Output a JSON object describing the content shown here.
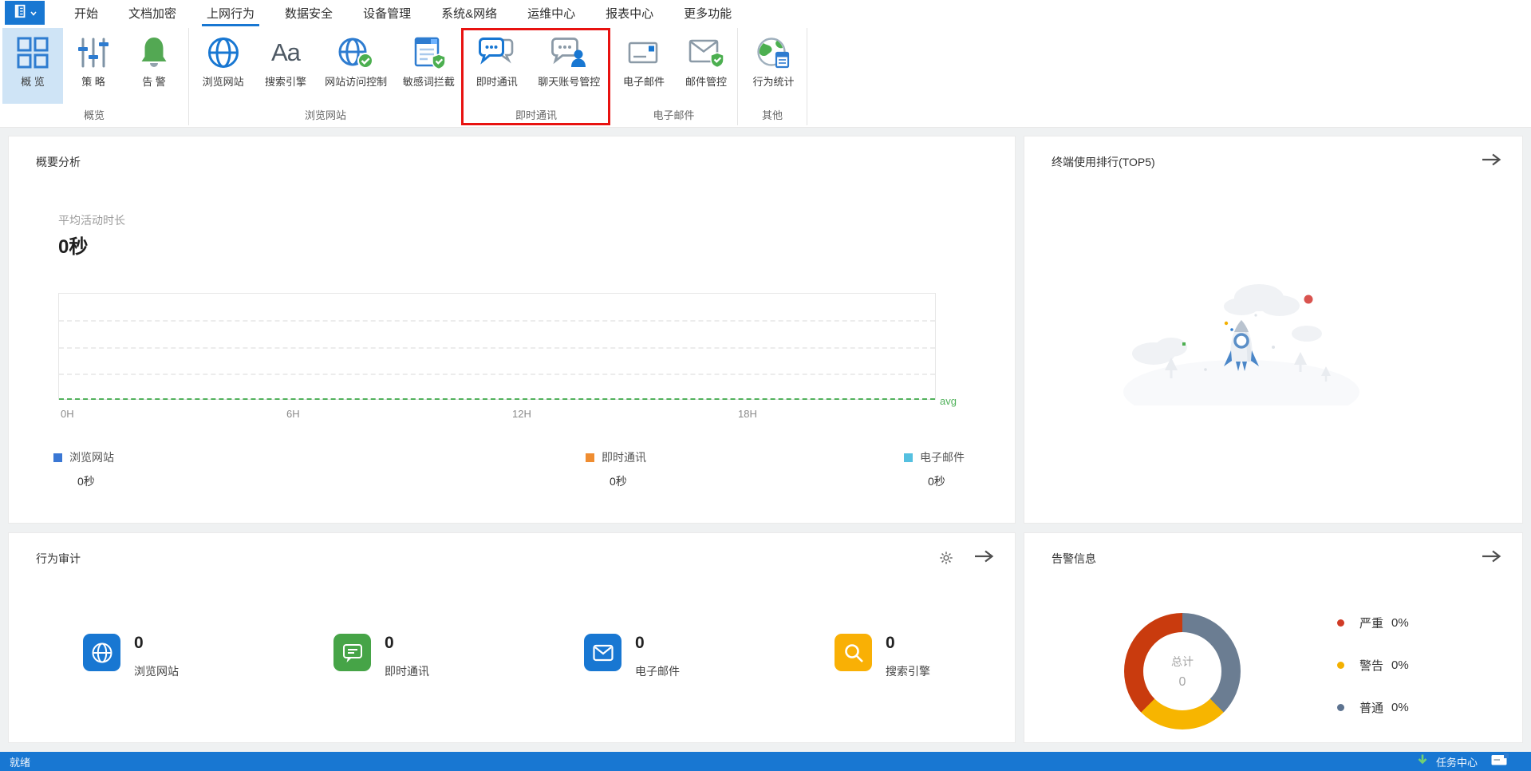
{
  "menu": {
    "items": [
      {
        "label": "开始"
      },
      {
        "label": "文档加密"
      },
      {
        "label": "上网行为",
        "active": true
      },
      {
        "label": "数据安全"
      },
      {
        "label": "设备管理"
      },
      {
        "label": "系统&网络"
      },
      {
        "label": "运维中心"
      },
      {
        "label": "报表中心"
      },
      {
        "label": "更多功能"
      }
    ]
  },
  "ribbon": {
    "groups": [
      {
        "label": "概览",
        "items": [
          {
            "label": "概 览",
            "icon": "overview-grid-icon",
            "selected": true
          },
          {
            "label": "策 略",
            "icon": "policy-sliders-icon"
          },
          {
            "label": "告 警",
            "icon": "alert-bell-icon"
          }
        ]
      },
      {
        "label": "浏览网站",
        "items": [
          {
            "label": "浏览网站",
            "icon": "browse-globe-icon"
          },
          {
            "label": "搜索引擎",
            "icon": "search-engine-aa-icon",
            "glyph": "Aa"
          },
          {
            "label": "网站访问控制",
            "icon": "site-access-globe-check-icon"
          },
          {
            "label": "敏感词拦截",
            "icon": "sensitive-word-shield-icon"
          }
        ]
      },
      {
        "label": "即时通讯",
        "highlighted_red_box": true,
        "items": [
          {
            "label": "即时通讯",
            "icon": "im-chat-icon"
          },
          {
            "label": "聊天账号管控",
            "icon": "chat-account-user-icon"
          }
        ]
      },
      {
        "label": "电子邮件",
        "items": [
          {
            "label": "电子邮件",
            "icon": "email-card-icon"
          },
          {
            "label": "邮件管控",
            "icon": "mail-shield-icon"
          }
        ]
      },
      {
        "label": "其他",
        "items": [
          {
            "label": "行为统计",
            "icon": "behavior-stats-globe-icon"
          }
        ]
      }
    ]
  },
  "cards": {
    "summary": {
      "title": "概要分析",
      "avg_label": "平均活动时长",
      "avg_value": "0秒"
    },
    "top5": {
      "title": "终端使用排行(TOP5)"
    },
    "audit": {
      "title": "行为审计",
      "stats": [
        {
          "value": "0",
          "label": "浏览网站",
          "color": "#1877d2",
          "icon": "globe-icon"
        },
        {
          "value": "0",
          "label": "即时通讯",
          "color": "#46a447",
          "icon": "chat-icon"
        },
        {
          "value": "0",
          "label": "电子邮件",
          "color": "#1877d2",
          "icon": "mail-icon"
        },
        {
          "value": "0",
          "label": "搜索引擎",
          "color": "#f9b005",
          "icon": "search-icon"
        }
      ]
    },
    "alarm": {
      "title": "告警信息"
    }
  },
  "chart_data": [
    {
      "type": "line",
      "title": "概要分析",
      "subtitle": "平均活动时长 0秒",
      "x_ticks": [
        "0H",
        "6H",
        "12H",
        "18H"
      ],
      "x_range_hours": [
        0,
        24
      ],
      "ylim": [
        0,
        1
      ],
      "grid": "dashed-horizontal",
      "series": [
        {
          "name": "浏览网站",
          "color": "#3a77d4",
          "total": "0秒",
          "values": [
            0,
            0,
            0,
            0,
            0
          ]
        },
        {
          "name": "即时通讯",
          "color": "#ef8d31",
          "total": "0秒",
          "values": [
            0,
            0,
            0,
            0,
            0
          ]
        },
        {
          "name": "电子邮件",
          "color": "#55c0e0",
          "total": "0秒",
          "values": [
            0,
            0,
            0,
            0,
            0
          ]
        }
      ],
      "avg_line": {
        "label": "avg",
        "value": 0,
        "color": "#52b25c",
        "style": "dashed"
      }
    },
    {
      "type": "donut",
      "title": "告警信息",
      "center_label": "总计",
      "center_value": "0",
      "legend_position": "right",
      "slices": [
        {
          "label": "严重",
          "pct": "0%",
          "color": "#c93b0e",
          "sweep_deg": 135
        },
        {
          "label": "警告",
          "pct": "0%",
          "color": "#f7b500",
          "sweep_deg": 90
        },
        {
          "label": "普通",
          "pct": "0%",
          "color": "#6b7d92",
          "sweep_deg": 135
        }
      ]
    }
  ],
  "statusbar": {
    "left": "就绪",
    "task_center": "任务中心"
  },
  "colors": {
    "primary_blue": "#1877d2",
    "selected_item_bg": "#cfe4f6",
    "highlight_red_box": "#e81210",
    "content_bg": "#eff1f2",
    "statusbar_bg": "#1877d2"
  }
}
